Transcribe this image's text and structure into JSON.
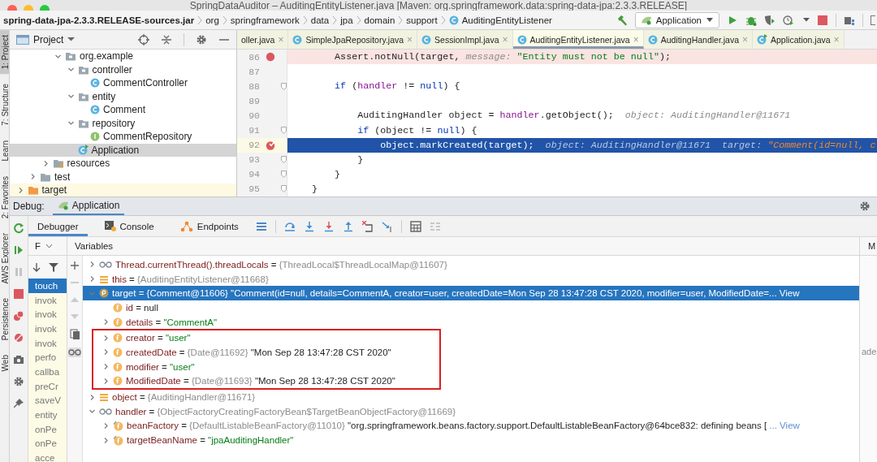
{
  "window": {
    "title": "SpringDataAuditor – AuditingEntityListener.java [Maven: org.springframework.data:spring-data-jpa:2.3.3.RELEASE]"
  },
  "breadcrumbs": [
    {
      "label": "spring-data-jpa-2.3.3.RELEASE-sources.jar",
      "kind": "jar"
    },
    {
      "label": "org",
      "kind": "package"
    },
    {
      "label": "springframework",
      "kind": "package"
    },
    {
      "label": "data",
      "kind": "package"
    },
    {
      "label": "jpa",
      "kind": "package"
    },
    {
      "label": "domain",
      "kind": "package"
    },
    {
      "label": "support",
      "kind": "package"
    },
    {
      "label": "AuditingEntityListener",
      "kind": "class"
    }
  ],
  "run_config": {
    "label": "Application"
  },
  "tool_strip": [
    {
      "label": "1: Project",
      "selected": true
    },
    {
      "label": "7: Structure",
      "selected": false
    },
    {
      "label": "Learn",
      "selected": false
    },
    {
      "label": "2: Favorites",
      "selected": false
    },
    {
      "label": "AWS Explorer",
      "selected": false
    },
    {
      "label": "Persistence",
      "selected": false
    },
    {
      "label": "Web",
      "selected": false
    }
  ],
  "project_panel": {
    "title": "Project",
    "tree": [
      {
        "children": [
          {
            "children": [
              {
                "children": [
                  {
                    "label": "org.example",
                    "kind": "package",
                    "expanded": true,
                    "selected": false,
                    "children": [
                      {
                        "label": "controller",
                        "kind": "package",
                        "expanded": true,
                        "selected": false,
                        "children": [
                          {
                            "label": "CommentController",
                            "kind": "class",
                            "selected": false
                          }
                        ]
                      },
                      {
                        "label": "entity",
                        "kind": "package",
                        "expanded": true,
                        "selected": false,
                        "children": [
                          {
                            "label": "Comment",
                            "kind": "class",
                            "selected": false
                          }
                        ]
                      },
                      {
                        "label": "repository",
                        "kind": "package",
                        "expanded": true,
                        "selected": false,
                        "children": [
                          {
                            "label": "CommentRepository",
                            "kind": "interface",
                            "selected": false
                          }
                        ]
                      },
                      {
                        "label": "Application",
                        "kind": "app",
                        "selected": true
                      }
                    ]
                  }
                ]
              },
              {
                "label": "resources",
                "kind": "resources",
                "expanded": false,
                "selected": false
              }
            ]
          },
          {
            "label": "test",
            "kind": "folder",
            "expanded": false,
            "selected": false
          }
        ]
      },
      {
        "label": "target",
        "kind": "excluded",
        "expanded": false,
        "selected": false
      }
    ]
  },
  "editor": {
    "tabs": [
      {
        "label": "oller.java",
        "close": "×",
        "selected": false
      },
      {
        "label": "SimpleJpaRepository.java",
        "kind": "class",
        "close": "×",
        "selected": false
      },
      {
        "label": "SessionImpl.java",
        "kind": "class",
        "close": "×",
        "selected": false
      },
      {
        "label": "AuditingEntityListener.java",
        "kind": "class",
        "close": "×",
        "selected": true
      },
      {
        "label": "AuditingHandler.java",
        "kind": "class",
        "close": "×",
        "selected": false
      },
      {
        "label": "Application.java",
        "kind": "app",
        "close": "×",
        "selected": false
      }
    ],
    "lines": [
      {
        "number": "86",
        "breakpoint": true,
        "current": false,
        "fold": false,
        "tokens": [
          {
            "kind": "plain",
            "text": "        Assert.notNull(target, "
          },
          {
            "kind": "hint",
            "text": "message: "
          },
          {
            "kind": "string",
            "text": "\"Entity must not be null\""
          },
          {
            "kind": "plain",
            "text": ");"
          }
        ]
      },
      {
        "number": "87",
        "breakpoint": false,
        "current": false,
        "fold": false
      },
      {
        "number": "88",
        "breakpoint": false,
        "current": false,
        "fold": true,
        "tokens": [
          {
            "kind": "kw",
            "text": "        if"
          },
          {
            "kind": "plain",
            "text": " ("
          },
          {
            "kind": "field",
            "text": "handler"
          },
          {
            "kind": "plain",
            "text": " != "
          },
          {
            "kind": "kw",
            "text": "null"
          },
          {
            "kind": "plain",
            "text": ") {"
          }
        ]
      },
      {
        "number": "89",
        "breakpoint": false,
        "current": false,
        "fold": false
      },
      {
        "number": "90",
        "breakpoint": false,
        "current": false,
        "fold": false,
        "tokens": [
          {
            "kind": "plain",
            "text": "            AuditingHandler object = "
          },
          {
            "kind": "field",
            "text": "handler"
          },
          {
            "kind": "plain",
            "text": ".getObject();"
          },
          {
            "kind": "hint",
            "text": "  object: AuditingHandler@11671"
          }
        ]
      },
      {
        "number": "91",
        "breakpoint": false,
        "current": false,
        "fold": true,
        "tokens": [
          {
            "kind": "kw",
            "text": "            if"
          },
          {
            "kind": "plain",
            "text": " (object != "
          },
          {
            "kind": "kw",
            "text": "null"
          },
          {
            "kind": "plain",
            "text": ") {"
          }
        ]
      },
      {
        "number": "92",
        "breakpoint": true,
        "current": true,
        "fold": false,
        "tokens": [
          {
            "kind": "plain",
            "text": "                object.markCreated(target);"
          },
          {
            "kind": "hint",
            "text": "  object: AuditingHandler@11671  target: "
          },
          {
            "kind": "hint-string",
            "text": "\"Comment(id=null, c"
          }
        ]
      },
      {
        "number": "93",
        "breakpoint": false,
        "current": false,
        "fold": true,
        "tokens": [
          {
            "kind": "plain",
            "text": "            }"
          }
        ]
      },
      {
        "number": "94",
        "breakpoint": false,
        "current": false,
        "fold": true,
        "tokens": [
          {
            "kind": "plain",
            "text": "        }"
          }
        ]
      },
      {
        "number": "95",
        "breakpoint": false,
        "current": false,
        "fold": true,
        "tokens": [
          {
            "kind": "plain",
            "text": "    }"
          }
        ]
      }
    ]
  },
  "debug": {
    "label": "Debug:",
    "session": "Application",
    "tabs": [
      {
        "label": "Debugger",
        "kind": "debugger",
        "selected": true
      },
      {
        "label": "Console",
        "kind": "console",
        "selected": false
      },
      {
        "label": "Endpoints",
        "kind": "endpoints",
        "selected": false
      }
    ],
    "frames": {
      "header": "F",
      "items": [
        {
          "label": "touch",
          "selected": true
        },
        {
          "label": "invok",
          "selected": false
        },
        {
          "label": "invok",
          "selected": false
        },
        {
          "label": "invok",
          "selected": false
        },
        {
          "label": "invok",
          "selected": false
        },
        {
          "label": "perfo",
          "selected": false
        },
        {
          "label": "callba",
          "selected": false
        },
        {
          "label": "preCr",
          "selected": false
        },
        {
          "label": "saveV",
          "selected": false
        },
        {
          "label": "entity",
          "selected": false
        },
        {
          "label": "onPe",
          "selected": false
        },
        {
          "label": "onPe",
          "selected": false
        },
        {
          "label": "acce",
          "selected": false
        }
      ]
    },
    "variables": {
      "header": "Variables",
      "items": [
        {
          "kind": "watch",
          "name": "Thread.currentThread().threadLocals",
          "sep": "=",
          "ref": "{ThreadLocal$ThreadLocalMap@11607}",
          "expanded": false,
          "selected": false
        },
        {
          "kind": "local",
          "name": "this",
          "sep": "=",
          "ref": "{AuditingEntityListener@11668}",
          "expanded": false,
          "selected": false
        },
        {
          "kind": "param",
          "name": "target",
          "sep": "=",
          "ref": "{Comment@11606}",
          "value": "\"Comment(id=null, details=CommentA, creator=user, createdDate=Mon Sep 28 13:47:28 CST 2020, modifier=user, ModifiedDate=...",
          "link": "View",
          "expanded": true,
          "selected": true,
          "children": [
            {
              "kind": "field",
              "name": "id",
              "sep": "=",
              "value": "null",
              "selected": false,
              "highlighted": false
            },
            {
              "kind": "field",
              "name": "details",
              "sep": "=",
              "string": "\"CommentA\"",
              "expanded": false,
              "selected": false,
              "highlighted": false
            },
            {
              "kind": "field",
              "name": "creator",
              "sep": "=",
              "string": "\"user\"",
              "expanded": false,
              "selected": false,
              "highlighted": true
            },
            {
              "kind": "field",
              "name": "createdDate",
              "sep": "=",
              "ref": "{Date@11692}",
              "value": "\"Mon Sep 28 13:47:28 CST 2020\"",
              "expanded": false,
              "selected": false,
              "highlighted": true
            },
            {
              "kind": "field",
              "name": "modifier",
              "sep": "=",
              "string": "\"user\"",
              "expanded": false,
              "selected": false,
              "highlighted": true
            },
            {
              "kind": "field",
              "name": "ModifiedDate",
              "sep": "=",
              "ref": "{Date@11693}",
              "value": "\"Mon Sep 28 13:47:28 CST 2020\"",
              "expanded": false,
              "selected": false,
              "highlighted": true
            }
          ]
        },
        {
          "kind": "local",
          "name": "object",
          "sep": "=",
          "ref": "{AuditingHandler@11671}",
          "expanded": false,
          "selected": false
        },
        {
          "kind": "watch",
          "name": "handler",
          "sep": "=",
          "ref": "{ObjectFactoryCreatingFactoryBean$TargetBeanObjectFactory@11669}",
          "expanded": true,
          "selected": false,
          "children": [
            {
              "kind": "field-final",
              "name": "beanFactory",
              "sep": "=",
              "ref": "{DefaultListableBeanFactory@11010}",
              "value": "\"org.springframework.beans.factory.support.DefaultListableBeanFactory@64bce832: defining beans [",
              "link": "... View",
              "expanded": false,
              "selected": false
            },
            {
              "kind": "field-final",
              "name": "targetBeanName",
              "sep": "=",
              "string": "\"jpaAuditingHandler\"",
              "expanded": false,
              "selected": false
            }
          ]
        }
      ]
    },
    "side_pane": {
      "tab": "M",
      "texts": [
        "ade"
      ]
    }
  }
}
